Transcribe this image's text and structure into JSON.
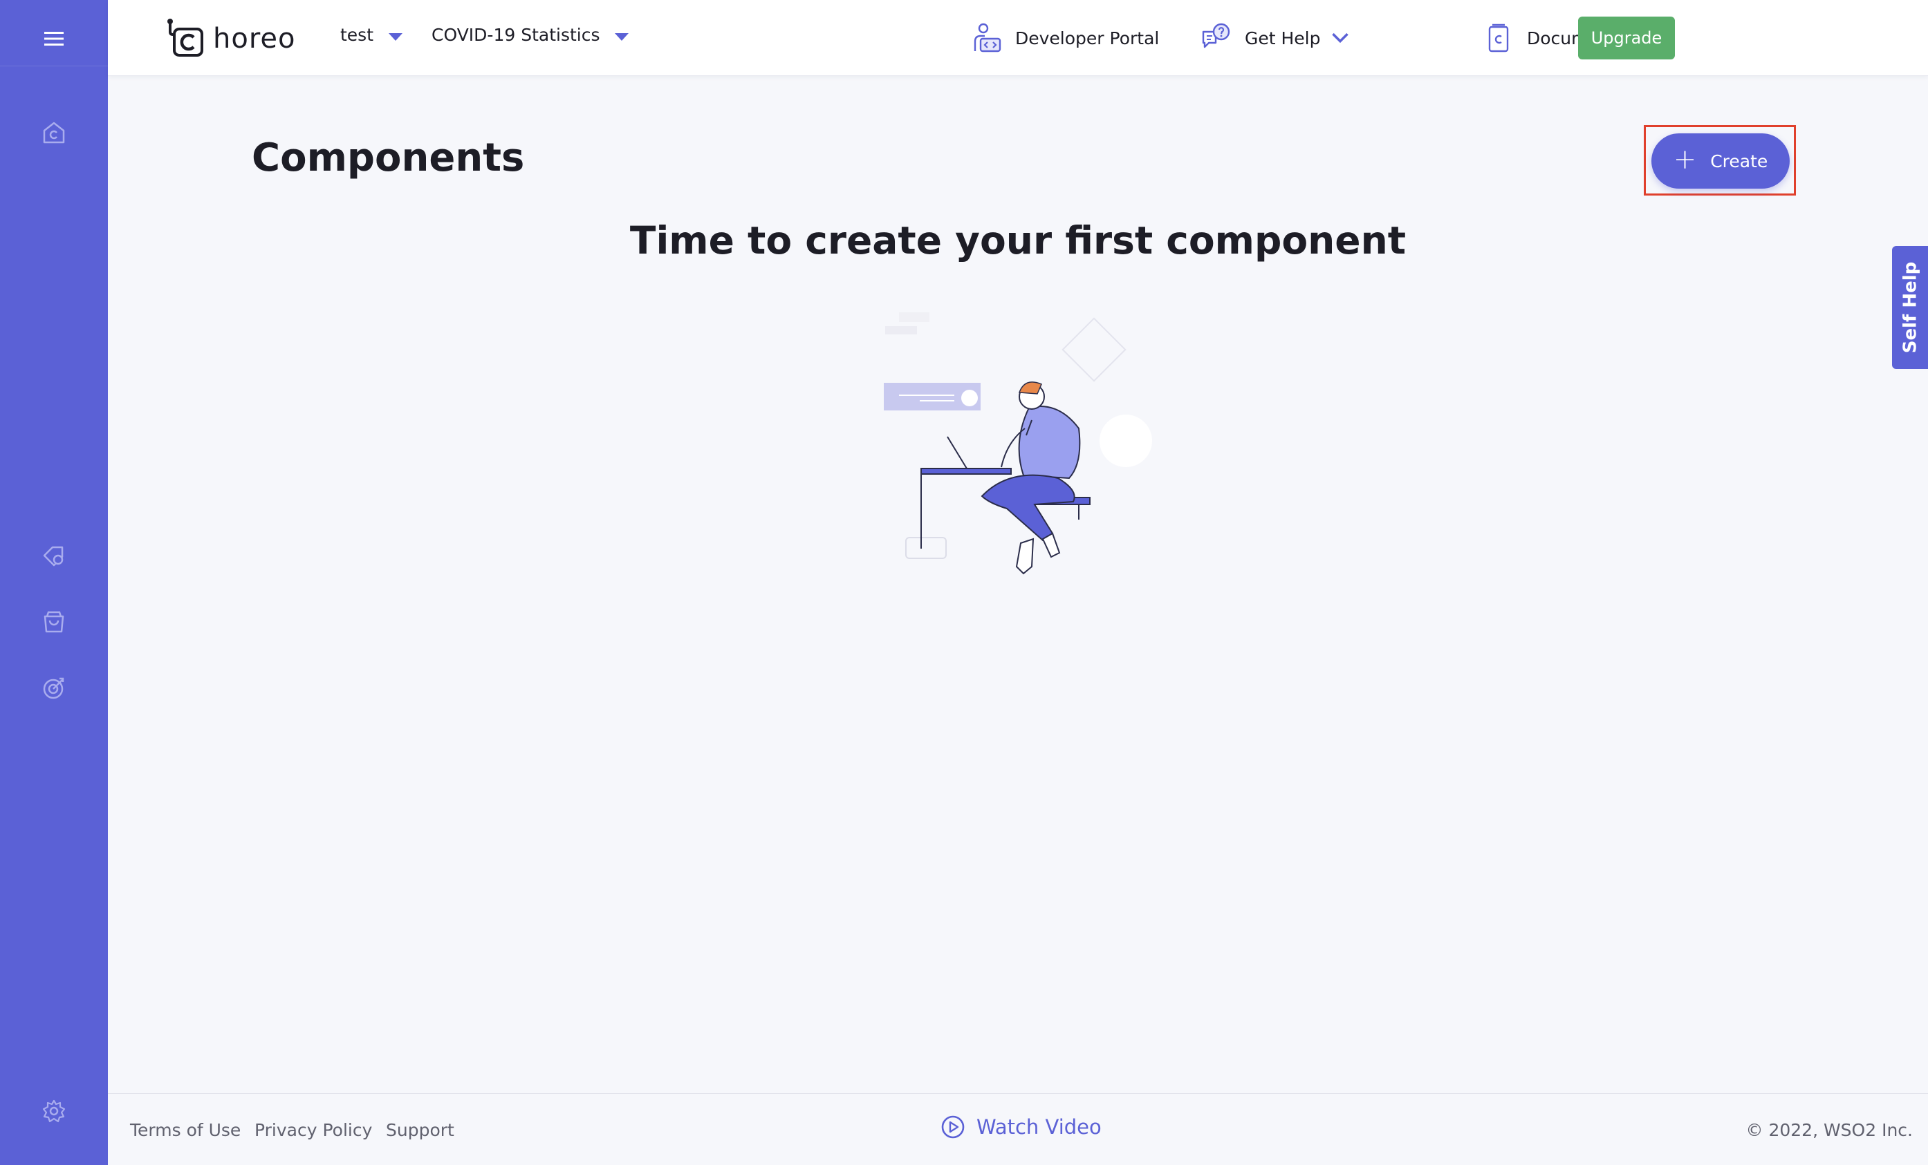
{
  "header": {
    "logo_text": "horeo",
    "org_dropdown": "test",
    "project_dropdown": "COVID-19 Statistics",
    "developer_portal": "Developer Portal",
    "get_help": "Get Help",
    "documentation": "Documentation",
    "upgrade": "Upgrade"
  },
  "sidebar": {
    "items": [
      {
        "icon": "menu-icon"
      },
      {
        "icon": "home-icon"
      },
      {
        "icon": "marketplace-icon"
      },
      {
        "icon": "bag-icon"
      },
      {
        "icon": "insights-icon"
      },
      {
        "icon": "settings-icon"
      }
    ]
  },
  "main": {
    "title": "Components",
    "create_label": "Create",
    "empty_title": "Time to create your first component"
  },
  "self_help": "Self Help",
  "footer": {
    "terms": "Terms of Use",
    "privacy": "Privacy Policy",
    "support": "Support",
    "watch_video": "Watch Video",
    "copyright": "© 2022, WSO2 Inc."
  },
  "colors": {
    "accent": "#5b61d6",
    "upgrade": "#5aae6a",
    "highlight": "#e0402c",
    "background": "#f6f7fb"
  }
}
